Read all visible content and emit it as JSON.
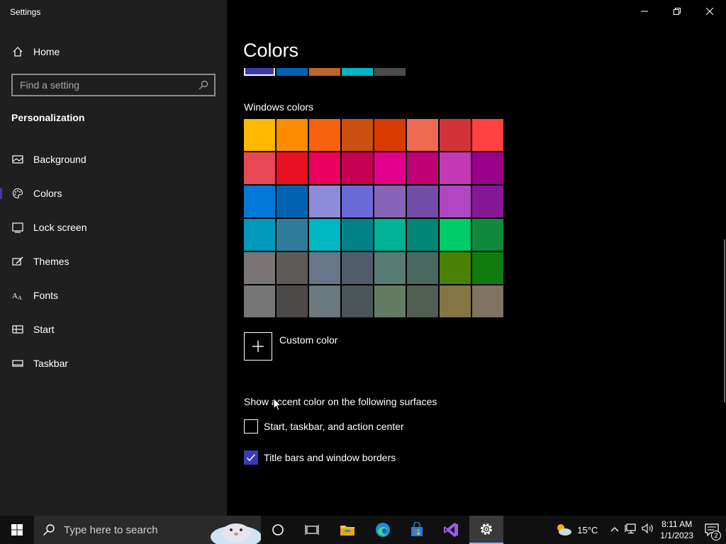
{
  "window": {
    "title": "Settings"
  },
  "sidebar": {
    "home": "Home",
    "search_placeholder": "Find a setting",
    "section": "Personalization",
    "items": [
      {
        "label": "Background",
        "icon": "image-icon"
      },
      {
        "label": "Colors",
        "icon": "palette-icon",
        "selected": true
      },
      {
        "label": "Lock screen",
        "icon": "lock-screen-icon"
      },
      {
        "label": "Themes",
        "icon": "themes-icon"
      },
      {
        "label": "Fonts",
        "icon": "fonts-icon"
      },
      {
        "label": "Start",
        "icon": "start-icon"
      },
      {
        "label": "Taskbar",
        "icon": "taskbar-icon"
      }
    ]
  },
  "main": {
    "title": "Colors",
    "recent_colors": [
      "#3b3ba8",
      "#0063b1",
      "#c0642e",
      "#00b7c3",
      "#4c4c4c"
    ],
    "windows_colors_label": "Windows colors",
    "windows_colors": [
      [
        "#ffb900",
        "#ff8c00",
        "#f7630c",
        "#ca5010",
        "#da3b01",
        "#ef6950",
        "#d13438",
        "#ff4343"
      ],
      [
        "#e74856",
        "#e81123",
        "#ea005e",
        "#c30052",
        "#e3008c",
        "#bf0077",
        "#c239b3",
        "#9a0089"
      ],
      [
        "#0078d7",
        "#0063b1",
        "#8e8cd8",
        "#6b69d6",
        "#8764b8",
        "#744da9",
        "#b146c2",
        "#881798"
      ],
      [
        "#0099bc",
        "#2d7d9a",
        "#00b7c3",
        "#038387",
        "#00b294",
        "#018574",
        "#00cc6a",
        "#10893e"
      ],
      [
        "#7a7574",
        "#5d5a58",
        "#68768a",
        "#515c6b",
        "#567c73",
        "#486860",
        "#498205",
        "#107c10"
      ],
      [
        "#767676",
        "#4c4a48",
        "#69797e",
        "#4a5459",
        "#647c64",
        "#525e54",
        "#847545",
        "#7e735f"
      ]
    ],
    "custom_color_label": "Custom color",
    "surfaces_label": "Show accent color on the following surfaces",
    "checkboxes": [
      {
        "label": "Start, taskbar, and action center",
        "checked": false
      },
      {
        "label": "Title bars and window borders",
        "checked": true
      }
    ]
  },
  "taskbar": {
    "search_placeholder": "Type here to search",
    "temperature": "15°C",
    "time": "8:11 AM",
    "date": "1/1/2023",
    "notification_count": "2"
  }
}
